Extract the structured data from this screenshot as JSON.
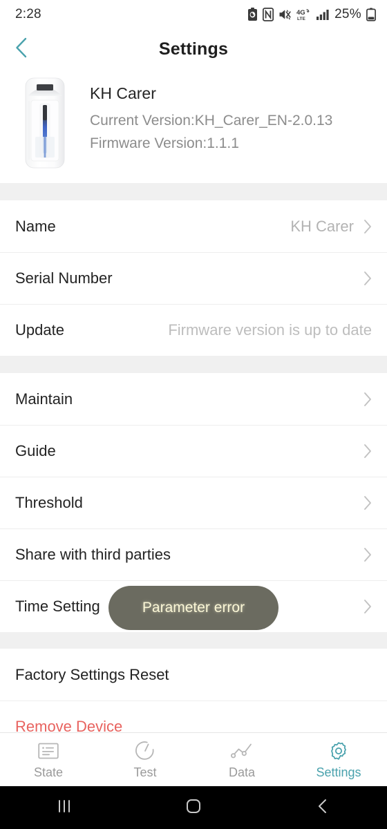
{
  "status_bar": {
    "time": "2:28",
    "battery_percent": "25%",
    "icons": [
      "battery-saver-icon",
      "nfc-icon",
      "mute-icon",
      "4g-lte-icon",
      "signal-bars-icon",
      "battery-icon"
    ]
  },
  "app_bar": {
    "title": "Settings",
    "back_icon": "chevron-left-icon",
    "accent_color": "#4aa2ad"
  },
  "device": {
    "name": "KH Carer",
    "current_version": "Current Version:KH_Carer_EN-2.0.13",
    "firmware_version": "Firmware Version:1.1.1",
    "image": "kh-carer-device-image"
  },
  "sections": [
    {
      "rows": [
        {
          "label": "Name",
          "value": "KH Carer",
          "chevron": true
        },
        {
          "label": "Serial Number",
          "value": "",
          "chevron": true
        },
        {
          "label": "Update",
          "value": "Firmware version is up to date",
          "chevron": false
        }
      ]
    },
    {
      "rows": [
        {
          "label": "Maintain",
          "value": "",
          "chevron": true
        },
        {
          "label": "Guide",
          "value": "",
          "chevron": true
        },
        {
          "label": "Threshold",
          "value": "",
          "chevron": true
        },
        {
          "label": "Share with third parties",
          "value": "",
          "chevron": true
        },
        {
          "label": "Time Setting",
          "value": "",
          "chevron": true
        }
      ]
    },
    {
      "rows": [
        {
          "label": "Factory Settings Reset",
          "value": "",
          "chevron": false
        },
        {
          "label": "Remove Device",
          "value": "",
          "chevron": false,
          "danger": true
        }
      ]
    }
  ],
  "toast": {
    "message": "Parameter error",
    "background_color": "#6b6b60",
    "text_color": "#fbf7d6"
  },
  "tab_bar": {
    "active": "Settings",
    "items": [
      {
        "label": "State",
        "icon": "card-list-icon"
      },
      {
        "label": "Test",
        "icon": "timer-icon"
      },
      {
        "label": "Data",
        "icon": "line-chart-icon"
      },
      {
        "label": "Settings",
        "icon": "gear-icon"
      }
    ]
  },
  "nav_bar": {
    "recents_icon": "recents-icon",
    "home_icon": "home-icon",
    "back_icon": "back-icon"
  }
}
